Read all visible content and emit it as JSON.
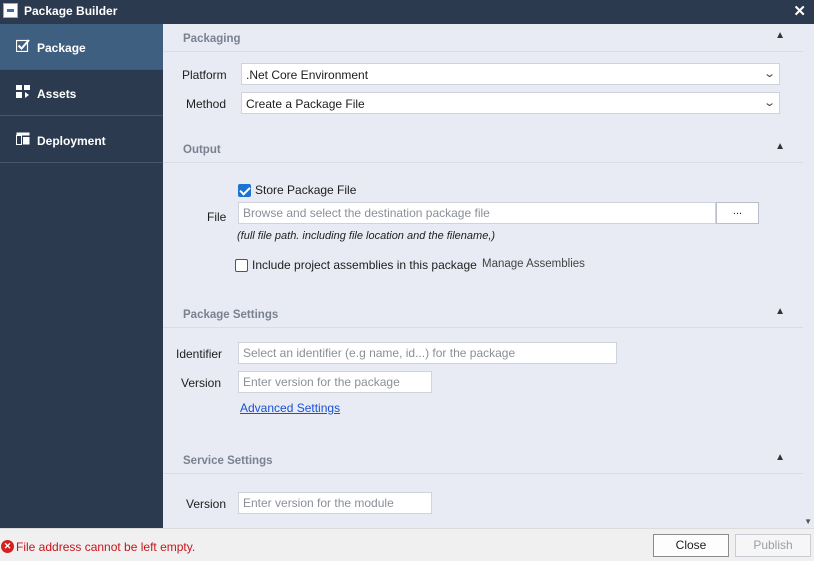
{
  "window": {
    "title": "Package Builder",
    "close_glyph": "✕"
  },
  "sidebar": {
    "items": [
      {
        "label": "Package",
        "icon": "checkbox-icon",
        "active": true
      },
      {
        "label": "Assets",
        "icon": "assets-icon",
        "active": false
      },
      {
        "label": "Deployment",
        "icon": "deployment-icon",
        "active": false
      }
    ]
  },
  "packaging": {
    "title": "Packaging",
    "platform_label": "Platform",
    "platform_value": ".Net Core Environment",
    "method_label": "Method",
    "method_value": "Create a Package File"
  },
  "output": {
    "title": "Output",
    "store_label": "Store Package File",
    "store_checked": true,
    "file_label": "File",
    "file_placeholder": "Browse and select the destination package file",
    "browse_label": "...",
    "hint": "(full file path. including file location and the filename,)",
    "include_label": "Include project assemblies in this package",
    "include_checked": false,
    "manage_label": "Manage Assemblies"
  },
  "package_settings": {
    "title": "Package Settings",
    "identifier_label": "Identifier",
    "identifier_placeholder": "Select an identifier (e.g name, id...) for the package",
    "version_label": "Version",
    "version_placeholder": "Enter version for the package",
    "advanced_label": "Advanced Settings"
  },
  "service_settings": {
    "title": "Service Settings",
    "version_label": "Version",
    "version_placeholder": "Enter version for the module"
  },
  "footer": {
    "error_text": "File address cannot be left empty.",
    "close_label": "Close",
    "publish_label": "Publish"
  },
  "colors": {
    "sidebar_bg": "#2b3a4e",
    "sidebar_active": "#3f5f80",
    "content_bg": "#e8ebf3",
    "error": "#c8151b",
    "link": "#1a4fd6",
    "checkbox_checked": "#1b73d3"
  }
}
